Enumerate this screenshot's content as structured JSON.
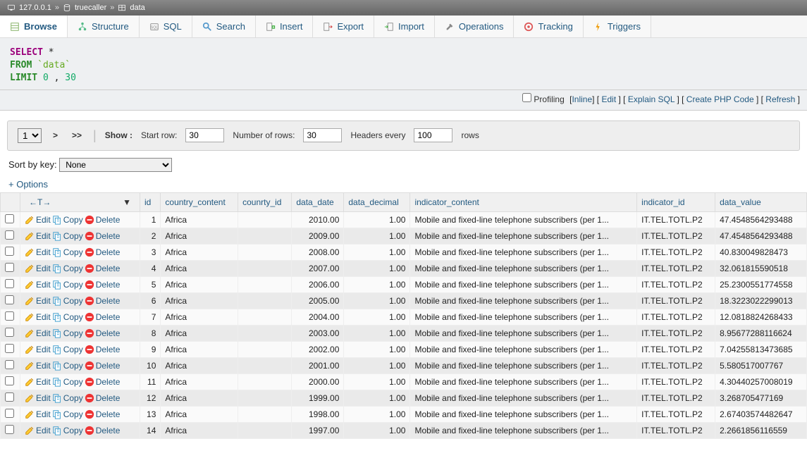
{
  "breadcrumb": {
    "server": "127.0.0.1",
    "db": "truecaller",
    "table": "data"
  },
  "tabs": [
    "Browse",
    "Structure",
    "SQL",
    "Search",
    "Insert",
    "Export",
    "Import",
    "Operations",
    "Tracking",
    "Triggers"
  ],
  "activeTab": "Browse",
  "sql": {
    "select": "SELECT",
    "star": "*",
    "from": "FROM",
    "table": "`data`",
    "limit": "LIMIT",
    "l0": "0",
    "comma": ",",
    "l1": "30"
  },
  "sqlactions": {
    "profiling": "Profiling",
    "inline": "Inline",
    "edit": "Edit",
    "explain": "Explain SQL",
    "php": "Create PHP Code",
    "refresh": "Refresh"
  },
  "nav": {
    "page": "1",
    "next": ">",
    "last": ">>",
    "showLabel": "Show :",
    "startLabel": "Start row:",
    "startVal": "30",
    "numrowsLabel": "Number of rows:",
    "numrowsVal": "30",
    "headersLabel": "Headers every",
    "headersVal": "100",
    "rowsLabel": "rows"
  },
  "sort": {
    "label": "Sort by key:",
    "value": "None"
  },
  "options": "+ Options",
  "arrowLeft": "←",
  "arrowT": "T",
  "arrowRight": "→",
  "sortDesc": "▼",
  "columns": [
    "id",
    "country_content",
    "counrty_id",
    "data_date",
    "data_decimal",
    "indicator_content",
    "indicator_id",
    "data_value"
  ],
  "actionLabels": {
    "edit": "Edit",
    "copy": "Copy",
    "delete": "Delete"
  },
  "rows": [
    {
      "id": "1",
      "country_content": "Africa",
      "counrty_id": "",
      "data_date": "2010.00",
      "data_decimal": "1.00",
      "indicator_content": "Mobile and fixed-line telephone subscribers (per 1...",
      "indicator_id": "IT.TEL.TOTL.P2",
      "data_value": "47.4548564293488"
    },
    {
      "id": "2",
      "country_content": "Africa",
      "counrty_id": "",
      "data_date": "2009.00",
      "data_decimal": "1.00",
      "indicator_content": "Mobile and fixed-line telephone subscribers (per 1...",
      "indicator_id": "IT.TEL.TOTL.P2",
      "data_value": "47.4548564293488"
    },
    {
      "id": "3",
      "country_content": "Africa",
      "counrty_id": "",
      "data_date": "2008.00",
      "data_decimal": "1.00",
      "indicator_content": "Mobile and fixed-line telephone subscribers (per 1...",
      "indicator_id": "IT.TEL.TOTL.P2",
      "data_value": "40.830049828473"
    },
    {
      "id": "4",
      "country_content": "Africa",
      "counrty_id": "",
      "data_date": "2007.00",
      "data_decimal": "1.00",
      "indicator_content": "Mobile and fixed-line telephone subscribers (per 1...",
      "indicator_id": "IT.TEL.TOTL.P2",
      "data_value": "32.061815590518"
    },
    {
      "id": "5",
      "country_content": "Africa",
      "counrty_id": "",
      "data_date": "2006.00",
      "data_decimal": "1.00",
      "indicator_content": "Mobile and fixed-line telephone subscribers (per 1...",
      "indicator_id": "IT.TEL.TOTL.P2",
      "data_value": "25.2300551774558"
    },
    {
      "id": "6",
      "country_content": "Africa",
      "counrty_id": "",
      "data_date": "2005.00",
      "data_decimal": "1.00",
      "indicator_content": "Mobile and fixed-line telephone subscribers (per 1...",
      "indicator_id": "IT.TEL.TOTL.P2",
      "data_value": "18.3223022299013"
    },
    {
      "id": "7",
      "country_content": "Africa",
      "counrty_id": "",
      "data_date": "2004.00",
      "data_decimal": "1.00",
      "indicator_content": "Mobile and fixed-line telephone subscribers (per 1...",
      "indicator_id": "IT.TEL.TOTL.P2",
      "data_value": "12.0818824268433"
    },
    {
      "id": "8",
      "country_content": "Africa",
      "counrty_id": "",
      "data_date": "2003.00",
      "data_decimal": "1.00",
      "indicator_content": "Mobile and fixed-line telephone subscribers (per 1...",
      "indicator_id": "IT.TEL.TOTL.P2",
      "data_value": "8.95677288116624"
    },
    {
      "id": "9",
      "country_content": "Africa",
      "counrty_id": "",
      "data_date": "2002.00",
      "data_decimal": "1.00",
      "indicator_content": "Mobile and fixed-line telephone subscribers (per 1...",
      "indicator_id": "IT.TEL.TOTL.P2",
      "data_value": "7.04255813473685"
    },
    {
      "id": "10",
      "country_content": "Africa",
      "counrty_id": "",
      "data_date": "2001.00",
      "data_decimal": "1.00",
      "indicator_content": "Mobile and fixed-line telephone subscribers (per 1...",
      "indicator_id": "IT.TEL.TOTL.P2",
      "data_value": "5.580517007767"
    },
    {
      "id": "11",
      "country_content": "Africa",
      "counrty_id": "",
      "data_date": "2000.00",
      "data_decimal": "1.00",
      "indicator_content": "Mobile and fixed-line telephone subscribers (per 1...",
      "indicator_id": "IT.TEL.TOTL.P2",
      "data_value": "4.30440257008019"
    },
    {
      "id": "12",
      "country_content": "Africa",
      "counrty_id": "",
      "data_date": "1999.00",
      "data_decimal": "1.00",
      "indicator_content": "Mobile and fixed-line telephone subscribers (per 1...",
      "indicator_id": "IT.TEL.TOTL.P2",
      "data_value": "3.268705477169"
    },
    {
      "id": "13",
      "country_content": "Africa",
      "counrty_id": "",
      "data_date": "1998.00",
      "data_decimal": "1.00",
      "indicator_content": "Mobile and fixed-line telephone subscribers (per 1...",
      "indicator_id": "IT.TEL.TOTL.P2",
      "data_value": "2.67403574482647"
    },
    {
      "id": "14",
      "country_content": "Africa",
      "counrty_id": "",
      "data_date": "1997.00",
      "data_decimal": "1.00",
      "indicator_content": "Mobile and fixed-line telephone subscribers (per 1...",
      "indicator_id": "IT.TEL.TOTL.P2",
      "data_value": "2.2661856116559"
    }
  ]
}
